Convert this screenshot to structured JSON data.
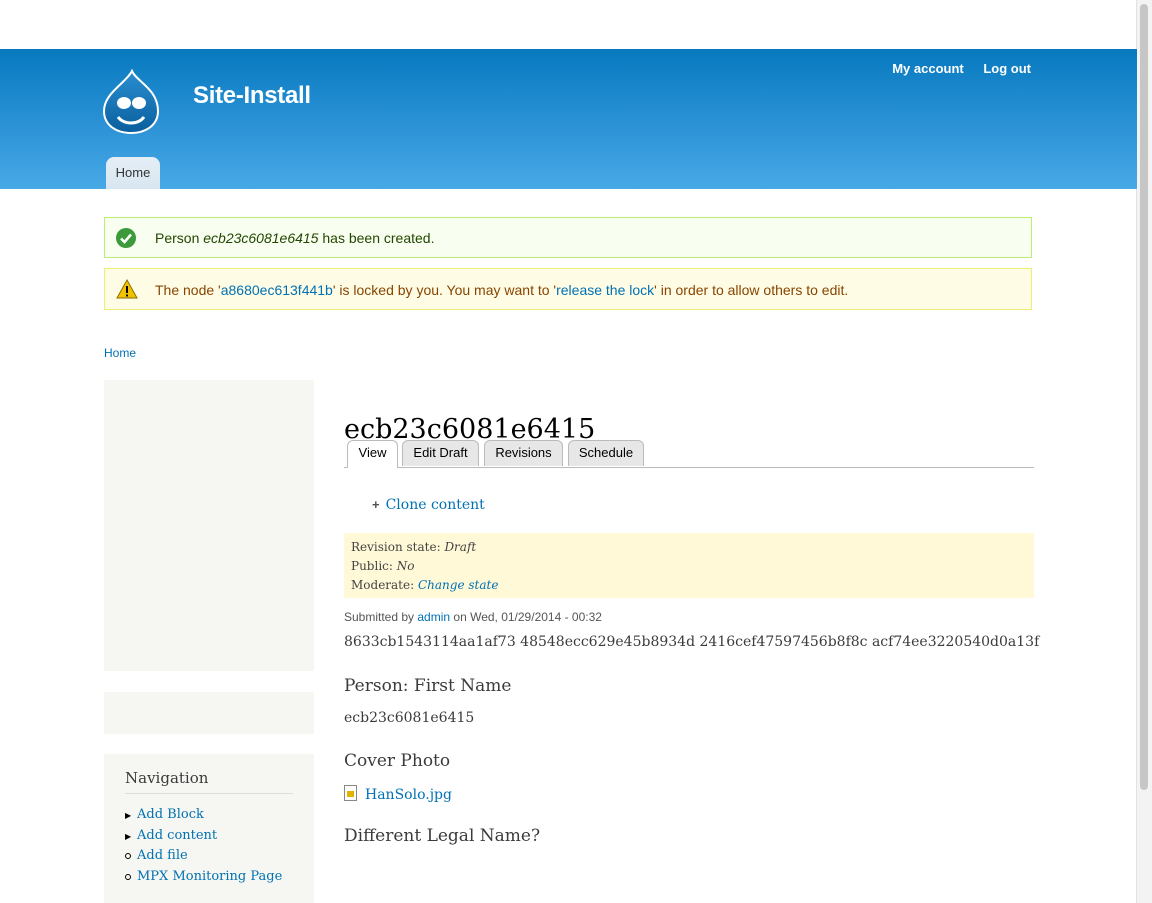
{
  "header": {
    "site_name": "Site-Install",
    "secondary_menu": [
      "My account",
      "Log out"
    ],
    "main_menu": [
      "Home"
    ]
  },
  "messages": {
    "status": {
      "prefix": "Person ",
      "name": "ecb23c6081e6415",
      "suffix": " has been created."
    },
    "warning": {
      "part1": "The node '",
      "node_link": "a8680ec613f441b",
      "part2": "' is locked by you. You may want to '",
      "release_link": "release the lock",
      "part3": "' in order to allow others to edit."
    }
  },
  "breadcrumb": "Home",
  "navigation": {
    "title": "Navigation",
    "items": [
      "Add Block",
      "Add content",
      "Add file",
      "MPX Monitoring Page"
    ]
  },
  "content": {
    "title": "ecb23c6081e6415",
    "tabs": [
      "View",
      "Edit Draft",
      "Revisions",
      "Schedule"
    ],
    "clone_label": "Clone content",
    "revision": {
      "state_label": "Revision state: ",
      "state_value": "Draft",
      "public_label": "Public: ",
      "public_value": "No",
      "moderate_label": "Moderate: ",
      "moderate_link": "Change state"
    },
    "submitted": {
      "prefix": "Submitted by ",
      "author": "admin",
      "suffix": " on Wed, 01/29/2014 - 00:32"
    },
    "hashes": "8633cb1543114aa1af73 48548ecc629e45b8934d 2416cef47597456b8f8c acf74ee3220540d0a13f",
    "fields": {
      "first_name_label": "Person: First Name",
      "first_name_value": "ecb23c6081e6415",
      "cover_photo_label": "Cover Photo",
      "cover_photo_file": "HanSolo.jpg",
      "legal_name_label": "Different Legal Name?"
    }
  }
}
